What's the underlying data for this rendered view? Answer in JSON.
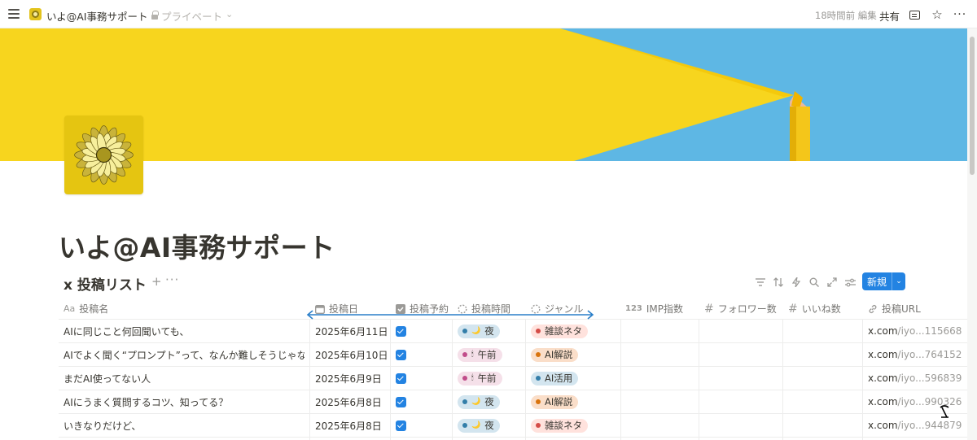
{
  "topbar": {
    "breadcrumb_title": "いよ@AI事務サポート",
    "privacy_label": "プライベート",
    "privacy_chevron": "⌄",
    "edited": "18時間前 編集",
    "share_label": "共有",
    "icons": [
      "menu-icon",
      "lock-icon",
      "comment-icon",
      "star-icon",
      "more-icon"
    ],
    "star_glyph": "☆",
    "more_glyph": "···"
  },
  "page": {
    "title": "いよ@AI事務サポート"
  },
  "database": {
    "title": "x 投稿リスト",
    "add_glyph": "+",
    "more_glyph": "···",
    "new_button_label": "新規",
    "new_button_chevron": "⌄",
    "tool_icons": [
      "filter-icon",
      "sort-icon",
      "automation-icon",
      "search-icon",
      "expand-icon",
      "settings-icon"
    ],
    "columns": [
      {
        "label": "投稿名",
        "icon": "Aa"
      },
      {
        "label": "投稿日",
        "icon": "calendar-icon"
      },
      {
        "label": "投稿予約",
        "icon": "checkbox-icon"
      },
      {
        "label": "投稿時間",
        "icon": "status-icon"
      },
      {
        "label": "ジャンル",
        "icon": "status-icon"
      },
      {
        "label": "IMP指数",
        "icon": "123"
      },
      {
        "label": "フォロワー数",
        "icon": "#"
      },
      {
        "label": "いいね数",
        "icon": "#"
      },
      {
        "label": "投稿URL",
        "icon": "link-icon"
      }
    ],
    "rows": [
      {
        "name": "AIに同じこと何回聞いても、",
        "date": "2025年6月11日",
        "reserved": true,
        "time": {
          "emoji": "🌙",
          "label": "夜"
        },
        "genre": "雑談ネタ",
        "url_host": "x.com",
        "url_rest": "/iyo...115668"
      },
      {
        "name": "AIでよく聞く“プロンプト”って、なんか難しそうじゃない",
        "date": "2025年6月10日",
        "reserved": true,
        "time": {
          "emoji": "🕯",
          "label": "午前"
        },
        "genre": "AI解説",
        "url_host": "x.com",
        "url_rest": "/iyo...764152"
      },
      {
        "name": "まだAI使ってない人",
        "date": "2025年6月9日",
        "reserved": true,
        "time": {
          "emoji": "🕯",
          "label": "午前"
        },
        "genre": "AI活用",
        "url_host": "x.com",
        "url_rest": "/iyo...596839"
      },
      {
        "name": "AIにうまく質問するコツ、知ってる？",
        "date": "2025年6月8日",
        "reserved": true,
        "time": {
          "emoji": "🌙",
          "label": "夜"
        },
        "genre": "AI解説",
        "url_host": "x.com",
        "url_rest": "/iyo...990326"
      },
      {
        "name": "いきなりだけど、",
        "date": "2025年6月8日",
        "reserved": true,
        "time": {
          "emoji": "🌙",
          "label": "夜"
        },
        "genre": "雑談ネタ",
        "url_host": "x.com",
        "url_rest": "/iyo...944879"
      }
    ]
  },
  "colors": {
    "accent": "#2383e2",
    "cover_blue": "#5eb7e4",
    "cover_yellow": "#f7d51e",
    "tag_night_bg": "#d3e5ef",
    "tag_night_dot": "#337ea9",
    "tag_morning_bg": "#f5e0e9",
    "tag_morning_dot": "#c14c8a",
    "genre_chat_bg": "#ffe2dd",
    "genre_chat_dot": "#d44c47",
    "genre_explain_bg": "#fadec9",
    "genre_explain_dot": "#d9730d",
    "genre_use_bg": "#d3e5ef",
    "genre_use_dot": "#337ea9"
  }
}
